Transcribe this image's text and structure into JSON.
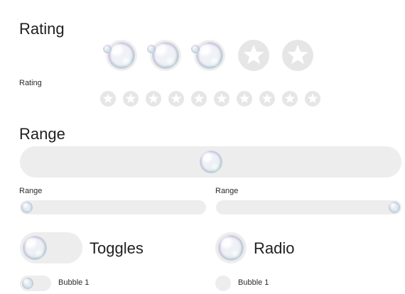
{
  "rating_section": {
    "title": "Rating",
    "large_rating": {
      "value": 3,
      "max": 5
    },
    "small_label": "Rating",
    "small_rating": {
      "value": 0,
      "max": 10
    }
  },
  "range_section": {
    "title": "Range",
    "main_slider": {
      "value": 0.5
    },
    "left_slider": {
      "label": "Range",
      "value": 0.0
    },
    "right_slider": {
      "label": "Range",
      "value": 1.0
    }
  },
  "toggles_section": {
    "title": "Toggles",
    "big_toggle": {
      "on": false
    },
    "item": {
      "label": "Bubble 1",
      "on": false
    }
  },
  "radio_section": {
    "title": "Radio",
    "big_radio": {
      "selected": true
    },
    "item": {
      "label": "Bubble 1",
      "selected": false
    }
  },
  "colors": {
    "track": "#ededed",
    "star_slot": "#e6e6e6"
  },
  "icons": {
    "star": "star-icon",
    "bubble": "bubble-icon"
  }
}
